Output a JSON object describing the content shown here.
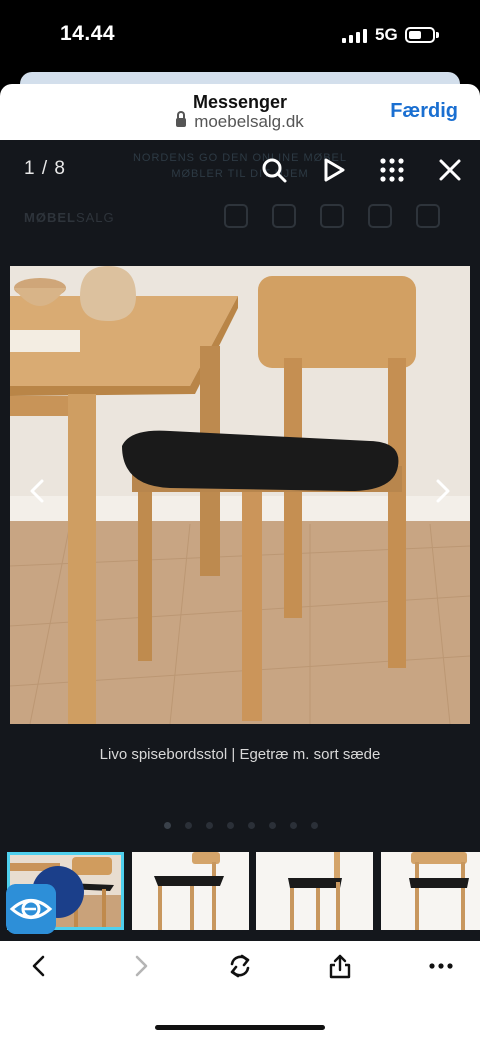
{
  "status_bar": {
    "time": "14.44",
    "network": "5G"
  },
  "header": {
    "title": "Messenger",
    "url": "moebelsalg.dk",
    "done_label": "Færdig"
  },
  "background_page": {
    "banner_line1": "NORDENS GO DEN ONLINE MØBEL",
    "banner_line2": "MØBLER TIL DIT HJEM",
    "logo_left": "MØBEL",
    "logo_right": "SALG"
  },
  "viewer": {
    "counter": "1 / 8",
    "caption": "Livo spisebordsstol | Egetræ m. sort sæde",
    "image_count": 8,
    "current_index": 1,
    "thumbnails": [
      "thumbnail-1",
      "thumbnail-2",
      "thumbnail-3",
      "thumbnail-4"
    ]
  },
  "icons": {
    "search": "search-icon",
    "play": "play-icon",
    "grid": "grid-icon",
    "close": "close-icon",
    "prev": "chevron-left-icon",
    "next": "chevron-right-icon",
    "accessibility": "eye-icon",
    "back": "back-icon",
    "forward": "forward-icon",
    "reload": "reload-icon",
    "share": "share-icon",
    "more": "more-icon"
  },
  "colors": {
    "accent": "#1a6fd1",
    "active_thumb_border": "#4fd0ee",
    "viewer_bg": "#14171c"
  }
}
